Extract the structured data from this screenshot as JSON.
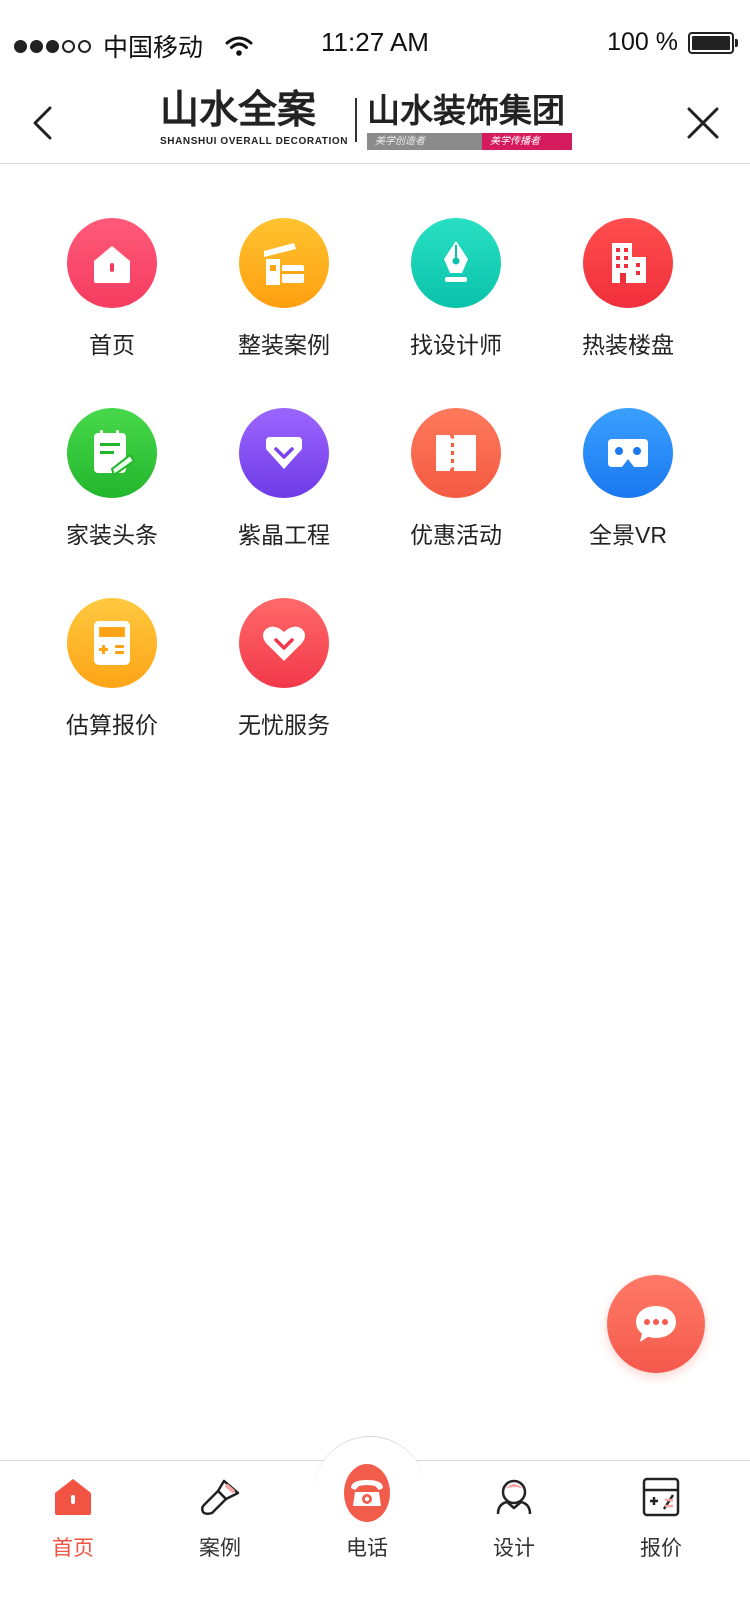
{
  "status_bar": {
    "carrier": "中国移动",
    "time": "11:27 AM",
    "battery": "100 %",
    "signal_filled": 3,
    "signal_total": 5
  },
  "nav": {
    "logo_left_cn": "山水全案",
    "logo_left_en": "SHANSHUI OVERALL DECORATION",
    "logo_right_cn": "山水装饰集团",
    "tagline_left": "美学创造者",
    "tagline_right": "美学传播者"
  },
  "grid": [
    {
      "label": "首页",
      "icon": "home-icon",
      "color": "#f53c5f"
    },
    {
      "label": "整装案例",
      "icon": "house-case-icon",
      "color": "#ff9f10"
    },
    {
      "label": "找设计师",
      "icon": "pen-nib-icon",
      "color": "#0ac2ab"
    },
    {
      "label": "热装楼盘",
      "icon": "building-icon",
      "color": "#f02f3c"
    },
    {
      "label": "家装头条",
      "icon": "notepad-icon",
      "color": "#22b62c"
    },
    {
      "label": "紫晶工程",
      "icon": "diamond-icon",
      "color": "#6f3be6"
    },
    {
      "label": "优惠活动",
      "icon": "ticket-icon",
      "color": "#f35a42"
    },
    {
      "label": "全景VR",
      "icon": "vr-glasses-icon",
      "color": "#1a78f0"
    },
    {
      "label": "估算报价",
      "icon": "calculator-icon",
      "color": "#ffa416"
    },
    {
      "label": "无忧服务",
      "icon": "heart-icon",
      "color": "#f2384a"
    }
  ],
  "tabs": [
    {
      "label": "首页",
      "icon": "home-icon",
      "active": true
    },
    {
      "label": "案例",
      "icon": "brush-icon",
      "active": false
    },
    {
      "label": "电话",
      "icon": "phone-icon",
      "active": false
    },
    {
      "label": "设计",
      "icon": "designer-icon",
      "active": false
    },
    {
      "label": "报价",
      "icon": "quote-icon",
      "active": false
    }
  ],
  "accent": "#f25443"
}
